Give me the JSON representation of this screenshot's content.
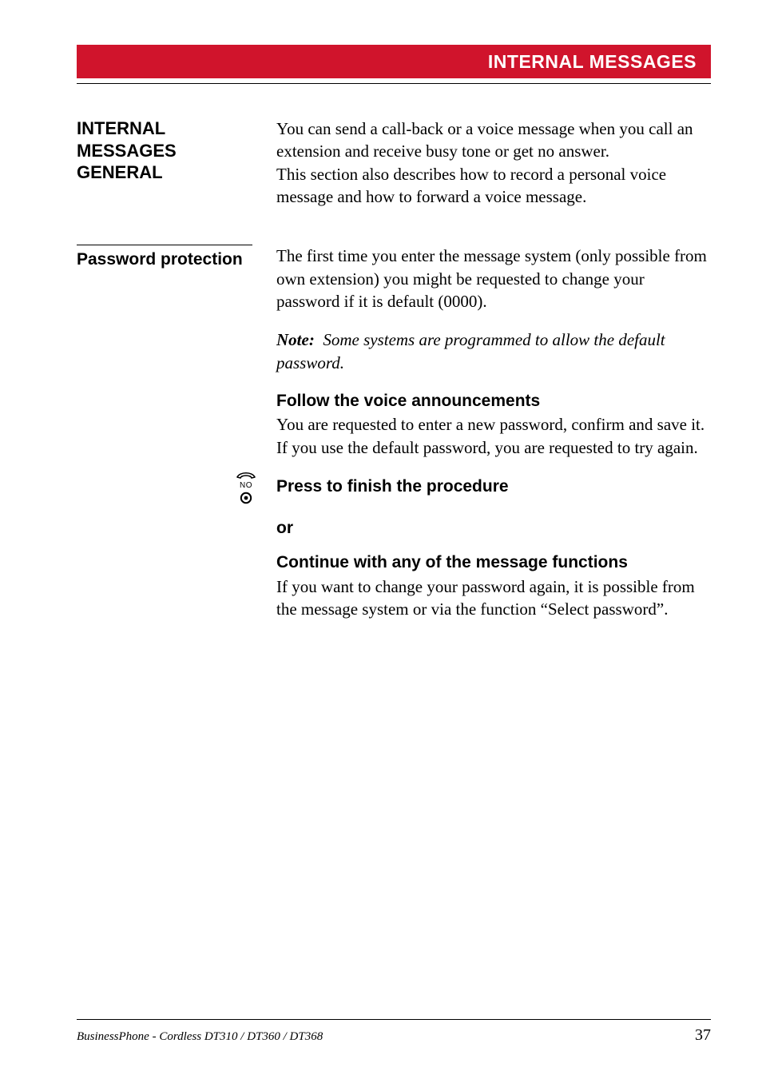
{
  "banner": {
    "title": "INTERNAL MESSAGES"
  },
  "section1": {
    "heading_line1": "INTERNAL MESSAGES",
    "heading_line2": "GENERAL",
    "body": "You can send a call-back or a voice message when you call an extension and receive busy tone or get no answer.\nThis section also describes how to record a personal voice message and how to forward a voice message."
  },
  "section2": {
    "heading": "Password protection",
    "body": "The first time you enter the message system (only possible from own extension) you might be requested to change your password if it is default (0000).",
    "note_label": "Note:",
    "note_body": "Some systems are programmed to allow the default password.",
    "follow_heading": "Follow the voice announcements",
    "follow_body": "You are requested to enter a new password, confirm and save it. If you use the default password, you are requested to try again."
  },
  "icon": {
    "no_label": "NO"
  },
  "press": {
    "text": "Press to finish the procedure"
  },
  "or": {
    "text": "or"
  },
  "continue": {
    "heading": "Continue with any of the message functions",
    "body": "If you want to change your password again, it is possible from the message system or via the function “Select password”."
  },
  "footer": {
    "left": "BusinessPhone - Cordless DT310 / DT360 / DT368",
    "page": "37"
  }
}
